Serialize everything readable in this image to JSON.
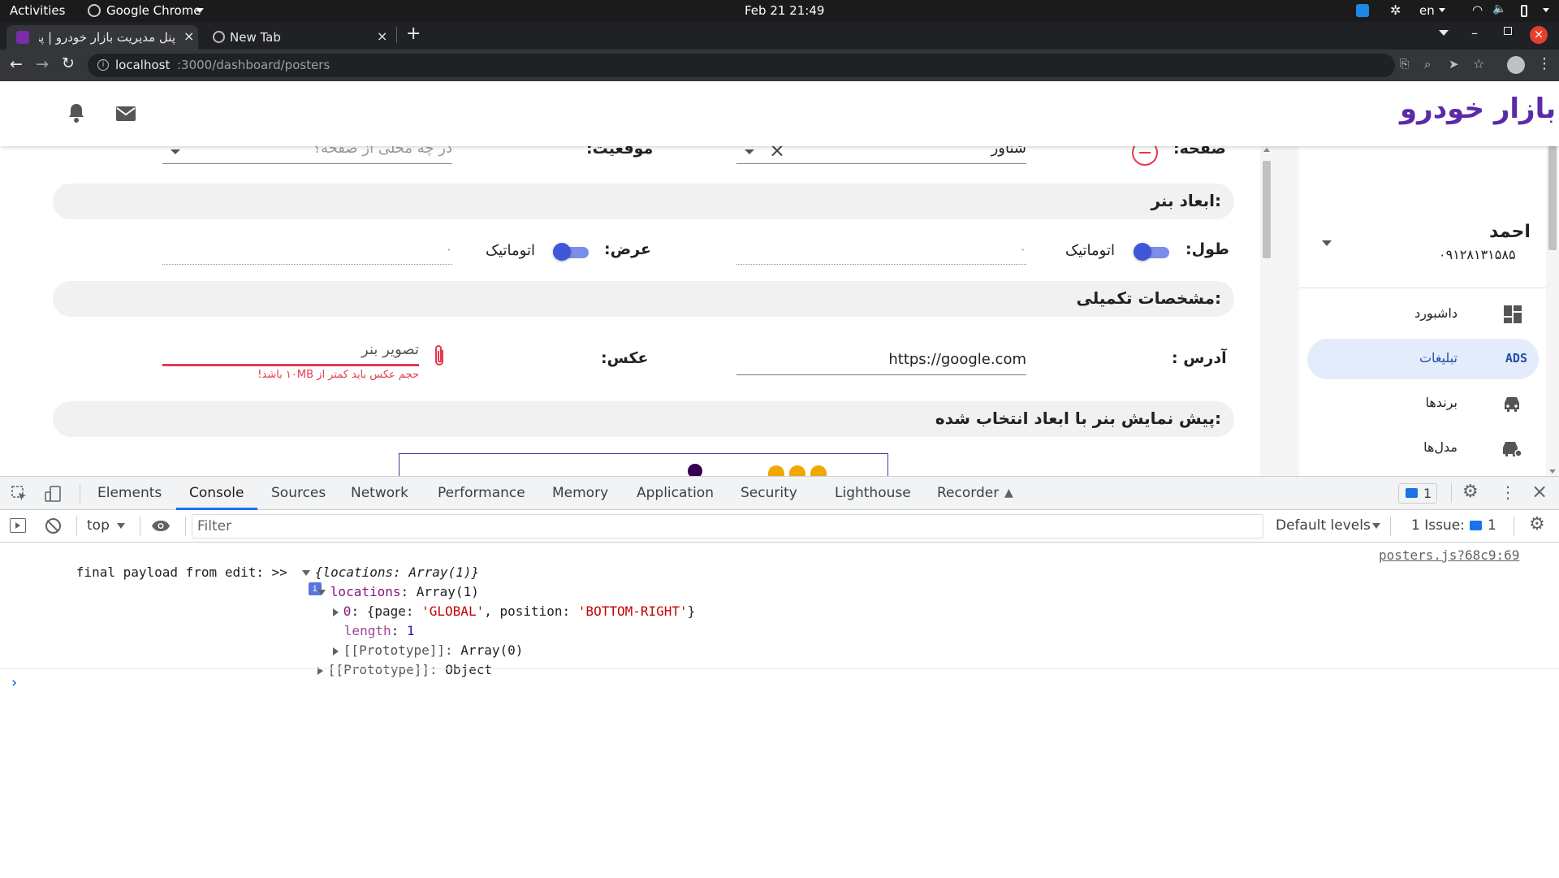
{
  "os_bar": {
    "activities": "Activities",
    "app_name": "Google Chrome",
    "clock": "Feb 21  21:49",
    "lang": "en"
  },
  "tabs": [
    {
      "title": "پنل مدیریت بازار خودرو | پنل"
    },
    {
      "title": "New Tab"
    }
  ],
  "address": {
    "host": "localhost",
    "path": ":3000/dashboard/posters"
  },
  "app": {
    "logo_text": "بازار خودرو",
    "user_name": "احمد",
    "user_phone": "۰۹۱۲۸۱۳۱۵۸۵",
    "nav": [
      {
        "label": "داشبورد",
        "icon": "dashboard-icon"
      },
      {
        "label": "تبلیغات",
        "icon": "ads-icon",
        "badge": "ADS"
      },
      {
        "label": "برندها",
        "icon": "car-icon"
      },
      {
        "label": "مدل‌ها",
        "icon": "car-settings-icon"
      }
    ]
  },
  "form": {
    "page_label": "صفحه:",
    "page_value": "شناور",
    "position_label": "موقعیت:",
    "position_placeholder": "در چه محلی از صفحه؟",
    "dims_title": "ابعاد بنر:",
    "height_label": "طول:",
    "height_auto": "اتوماتیک",
    "height_value": "۰",
    "width_label": "عرض:",
    "width_auto": "اتوماتیک",
    "width_value": "۰",
    "extra_title": "مشخصات تکمیلی:",
    "address_label": "آدرس :",
    "address_value": "https://google.com",
    "image_label": "عکس:",
    "image_placeholder": "تصویر بنر",
    "image_error": "حجم عکس باید کمتر از ۱۰MB باشد!",
    "preview_title": "پیش نمایش بنر با ابعاد انتخاب شده:"
  },
  "devtools": {
    "tabs": [
      "Elements",
      "Console",
      "Sources",
      "Network",
      "Performance",
      "Memory",
      "Application",
      "Security",
      "Lighthouse",
      "Recorder"
    ],
    "active_tab": "Console",
    "issues_badge": "1",
    "context": "top",
    "filter_placeholder": "Filter",
    "levels": "Default levels",
    "issues_label": "1 Issue:",
    "issues_count": "1",
    "log": {
      "message": "final payload from edit: >>",
      "summary": "{locations: Array(1)}",
      "source": "posters.js?68c9:69",
      "locations_key": "locations",
      "locations_val": "Array(1)",
      "item_index": "0",
      "item_page_key": "page",
      "item_page_val": "'GLOBAL'",
      "item_pos_key": "position",
      "item_pos_val": "'BOTTOM-RIGHT'",
      "length_key": "length",
      "length_val": "1",
      "proto_array_key": "[[Prototype]]",
      "proto_array_val": "Array(0)",
      "proto_obj_key": "[[Prototype]]",
      "proto_obj_val": "Object"
    }
  },
  "colors": {
    "brand": "#5b2aa8",
    "accent_yellow": "#f0a800",
    "error": "#e53950",
    "toggle": "#3d57d8"
  }
}
